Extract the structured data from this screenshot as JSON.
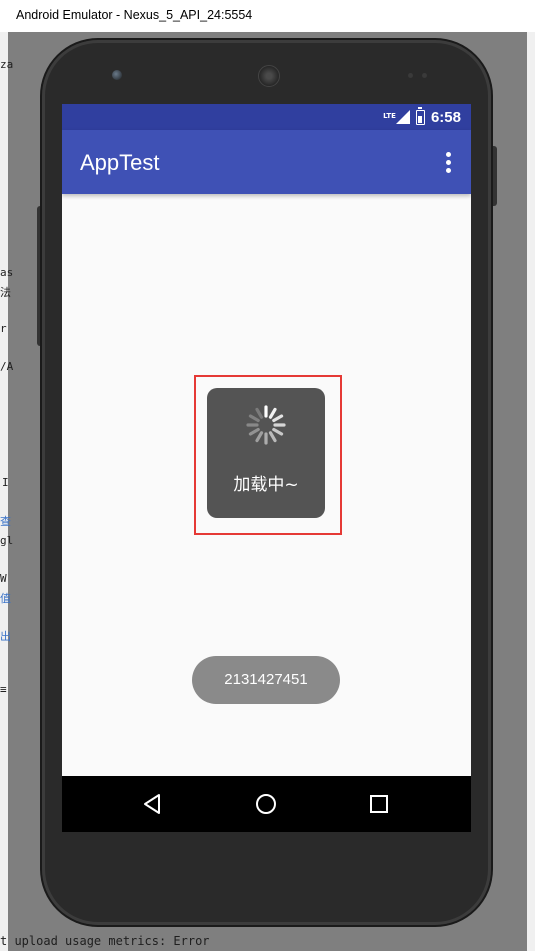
{
  "window": {
    "title": "Android Emulator - Nexus_5_API_24:5554"
  },
  "background_ide": {
    "fragments": [
      "za",
      "as",
      "法",
      "r",
      "/A",
      "I",
      "查",
      "gl",
      "W",
      "值",
      "出",
      "≡"
    ],
    "bottom_line": "t upload usage metrics: Error"
  },
  "status_bar": {
    "network": "LTE",
    "time": "6:58"
  },
  "app_bar": {
    "title": "AppTest",
    "overflow_icon": "more-vert-icon"
  },
  "loading_dialog": {
    "text": "加载中~",
    "spinner_icon": "spinner-icon"
  },
  "toast": {
    "text": "2131427451"
  },
  "navigation_bar": {
    "back_icon": "back-triangle-icon",
    "home_icon": "home-circle-icon",
    "recents_icon": "recents-square-icon"
  },
  "colors": {
    "status_bar": "#303f9f",
    "app_bar": "#3f51b5",
    "dialog": "#545454",
    "toast": "#8a8a8a",
    "highlight": "#e53935",
    "screen_bg": "#fafafa"
  }
}
